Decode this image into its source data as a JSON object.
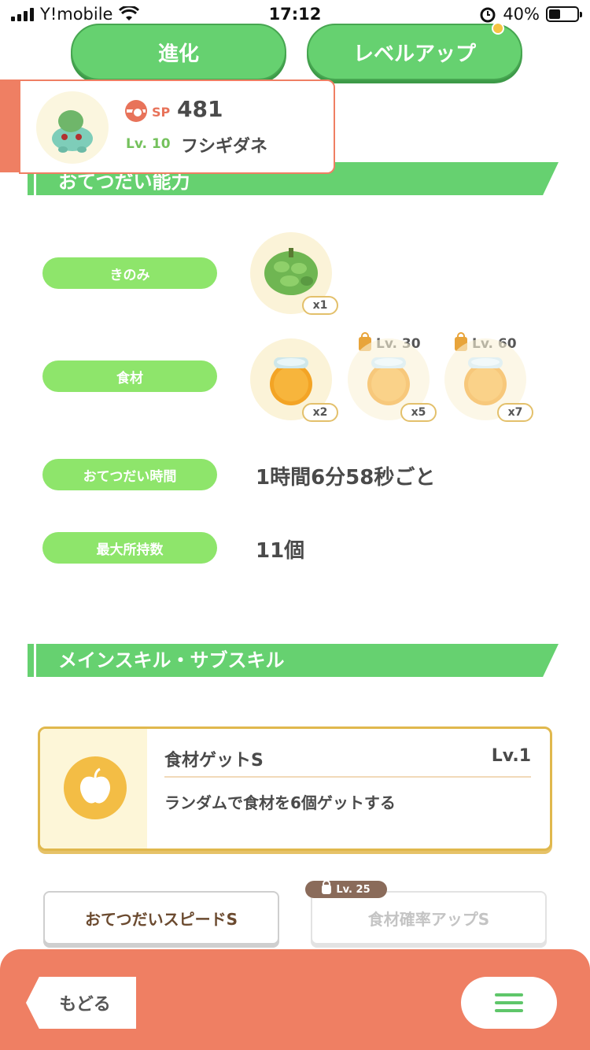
{
  "status_bar": {
    "carrier": "Y!mobile",
    "time": "17:12",
    "battery": "40%"
  },
  "top_buttons": {
    "evolve": "進化",
    "level_up": "レベルアップ"
  },
  "pokemon": {
    "sp_label": "SP",
    "sp_value": "481",
    "level": "Lv. 10",
    "name": "フシギダネ"
  },
  "help_section": {
    "title": "おてつだい能力",
    "berry_label": "きのみ",
    "berry_count": "x1",
    "ingredient_label": "食材",
    "ingredients": [
      {
        "count": "x2",
        "unlock": "",
        "locked": false
      },
      {
        "count": "x5",
        "unlock": "Lv. 30",
        "locked": true
      },
      {
        "count": "x7",
        "unlock": "Lv. 60",
        "locked": true
      }
    ],
    "help_time_label": "おてつだい時間",
    "help_time_value": "1時間6分58秒ごと",
    "max_carry_label": "最大所持数",
    "max_carry_value": "11個"
  },
  "skills_section": {
    "title": "メインスキル・サブスキル",
    "main_skill": {
      "name": "食材ゲットS",
      "level": "Lv.1",
      "description": "ランダムで食材を6個ゲットする"
    },
    "sub_skills": [
      {
        "name": "おてつだいスピードS",
        "locked": false
      },
      {
        "name": "食材確率アップS",
        "locked": true,
        "unlock": "Lv. 25"
      }
    ]
  },
  "bottom_bar": {
    "back": "もどる"
  },
  "colors": {
    "green": "#66d170",
    "light_green": "#8ee56b",
    "coral": "#ef7f63",
    "gold": "#e0b84d"
  }
}
